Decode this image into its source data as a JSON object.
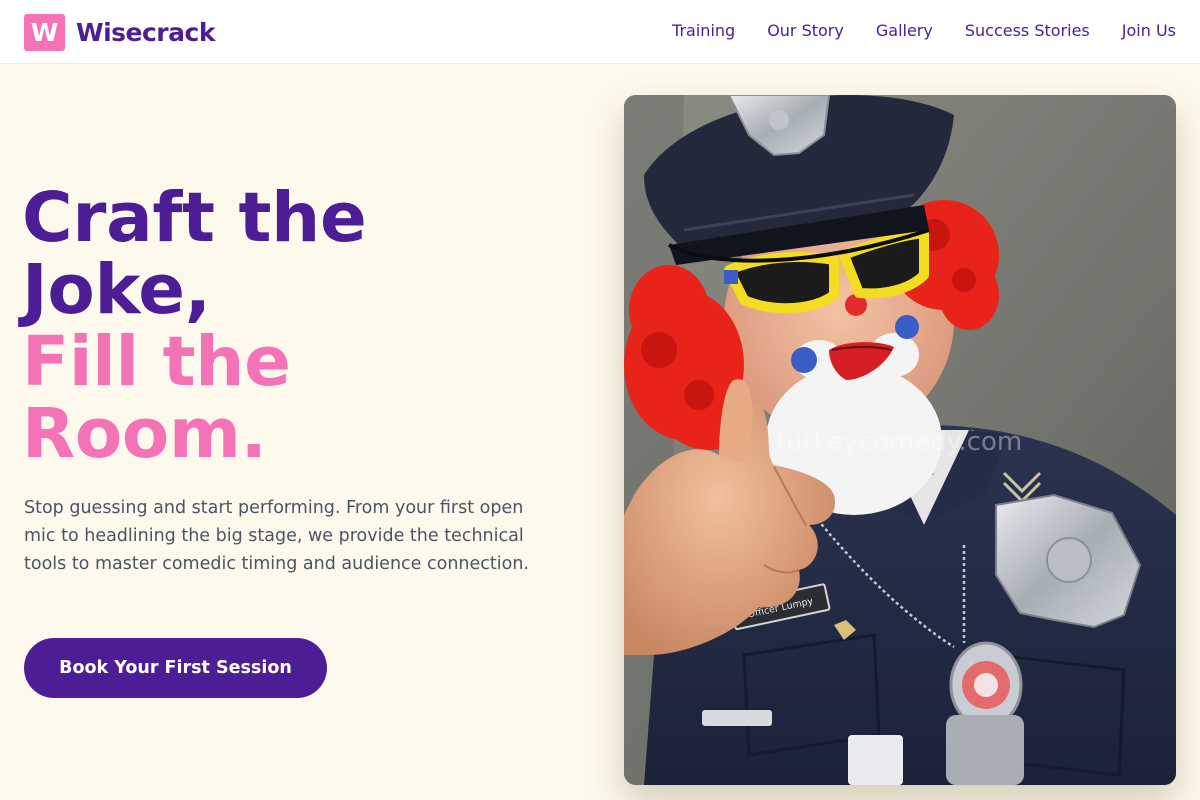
{
  "brand": {
    "logo_letter": "W",
    "name": "Wisecrack",
    "logo_color": "#f472b6",
    "name_color": "#4c1d95"
  },
  "nav": {
    "items": [
      {
        "label": "Training"
      },
      {
        "label": "Our Story"
      },
      {
        "label": "Gallery"
      },
      {
        "label": "Success Stories"
      },
      {
        "label": "Join Us"
      }
    ]
  },
  "hero": {
    "title_line1": "Craft the",
    "title_line2": "Joke,",
    "title_line3": "Fill the",
    "title_line4": "Room.",
    "description": "Stop guessing and start performing. From your first open mic to headlining the big stage, we provide the technical tools to master comedic timing and audience connection.",
    "cta_label": "Book Your First Session",
    "image": {
      "watermark": "turkeycomedy.com",
      "name_tag": "Officer Lumpy"
    }
  },
  "colors": {
    "page_background": "#fdf9ec",
    "primary_purple": "#4c1d95",
    "accent_pink": "#f472b6",
    "body_text": "#4b5563"
  }
}
